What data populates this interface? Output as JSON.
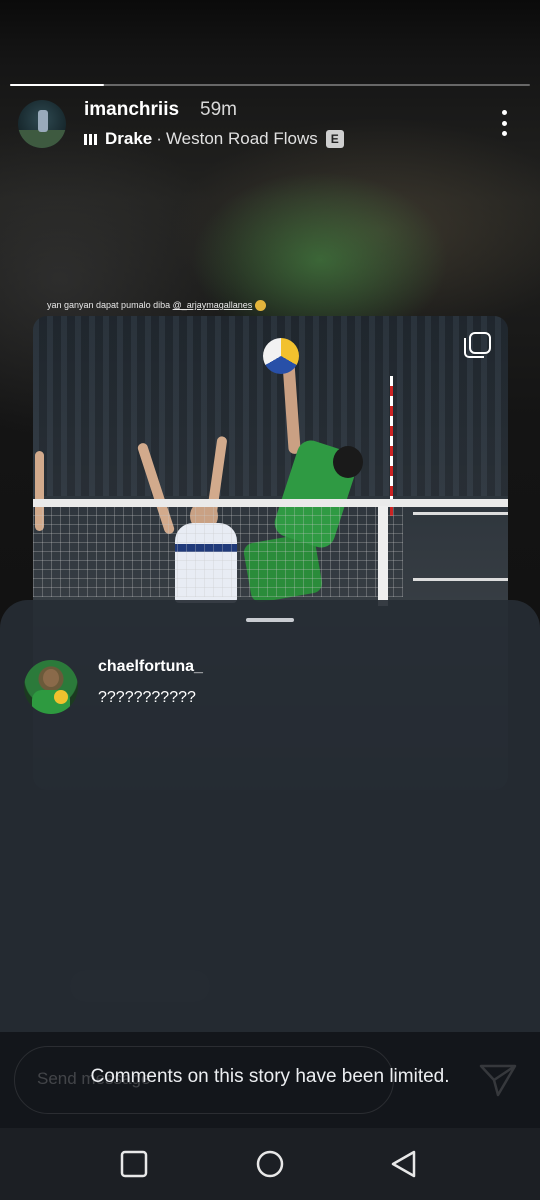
{
  "story": {
    "progress": 0.18,
    "username": "imanchriis",
    "time": "59m",
    "music": {
      "artist": "Drake",
      "separator": "·",
      "song": "Weston Road Flows",
      "explicit_badge": "E"
    }
  },
  "post": {
    "caption_text": "yan ganyan dapat pumalo diba ",
    "caption_mention": "@_arjaymagallanes"
  },
  "comments_sheet": {
    "comments": [
      {
        "username": "chaelfortuna_",
        "text": "???????????"
      }
    ]
  },
  "input": {
    "placeholder": "Send message"
  },
  "notice": "Comments on this story have been limited.",
  "icons": {
    "more": "more-vertical-icon",
    "multi": "carousel-icon",
    "send": "send-icon",
    "recent": "square-nav-icon",
    "home": "circle-nav-icon",
    "back": "triangle-back-icon"
  }
}
